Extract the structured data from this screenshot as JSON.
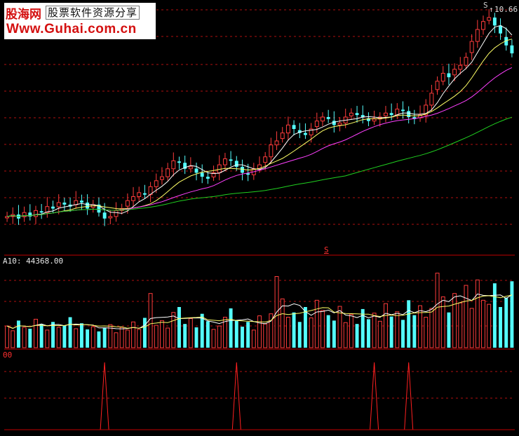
{
  "watermark": {
    "brand": "股海网",
    "subtitle": "股票软件资源分享",
    "url": "Www.Guhai.com.cn"
  },
  "labels": {
    "price_high": "10.66",
    "price_high_marker": "↑",
    "price_s_marker": "S",
    "mid_marker": "S",
    "volume_ma": "A10: 44368.00",
    "indicator": "00"
  },
  "colors": {
    "background": "#000000",
    "up": "#ff3c3c",
    "down": "#54ffff",
    "ma5": "#ffffff",
    "ma10": "#ffff66",
    "ma20": "#ff40ff",
    "ma60": "#20d020",
    "grid": "#b01010",
    "indicator": "#ff2020"
  },
  "chart_data": [
    {
      "type": "candlestick",
      "panel": "price",
      "series_names": [
        "MA5",
        "MA10",
        "MA20",
        "MA60"
      ],
      "ylim": [
        4.6,
        10.8
      ],
      "closes": [
        5.5,
        5.55,
        5.45,
        5.6,
        5.5,
        5.65,
        5.6,
        5.75,
        5.7,
        5.85,
        5.8,
        5.75,
        5.9,
        5.85,
        5.7,
        5.8,
        5.6,
        5.45,
        5.5,
        5.65,
        5.7,
        5.9,
        6.0,
        6.1,
        6.05,
        6.25,
        6.4,
        6.5,
        6.7,
        6.9,
        6.85,
        6.7,
        6.75,
        6.6,
        6.5,
        6.45,
        6.6,
        6.8,
        6.95,
        6.9,
        6.75,
        6.6,
        6.55,
        6.7,
        6.8,
        7.0,
        7.3,
        7.4,
        7.6,
        7.8,
        7.7,
        7.6,
        7.55,
        7.7,
        7.9,
        8.0,
        7.95,
        7.8,
        7.85,
        8.0,
        8.1,
        8.05,
        8.0,
        7.9,
        7.95,
        8.0,
        8.1,
        8.05,
        8.2,
        8.15,
        8.0,
        7.95,
        8.05,
        8.3,
        8.6,
        8.9,
        9.1,
        9.0,
        9.2,
        9.3,
        9.5,
        9.9,
        10.2,
        10.4,
        10.5,
        10.3,
        10.1,
        9.8,
        9.6
      ]
    },
    {
      "type": "bar",
      "panel": "volume",
      "series_names": [
        "VOL",
        "MA5",
        "MA10"
      ],
      "ylim": [
        0,
        120000
      ],
      "values": [
        32000,
        25000,
        40000,
        30000,
        28000,
        42000,
        35000,
        26000,
        38000,
        30000,
        33000,
        45000,
        28000,
        36000,
        27000,
        31000,
        24000,
        29000,
        34000,
        22000,
        30000,
        26000,
        38000,
        27000,
        44000,
        80000,
        33000,
        40000,
        29000,
        52000,
        60000,
        35000,
        43000,
        30000,
        50000,
        39000,
        27000,
        32000,
        45000,
        58000,
        40000,
        31000,
        38000,
        26000,
        47000,
        35000,
        50000,
        105000,
        72000,
        45000,
        52000,
        38000,
        60000,
        44000,
        70000,
        55000,
        48000,
        40000,
        61000,
        37000,
        49000,
        35000,
        57000,
        42000,
        51000,
        39000,
        65000,
        46000,
        53000,
        41000,
        70000,
        48000,
        62000,
        45000,
        58000,
        110000,
        75000,
        52000,
        80000,
        66000,
        92000,
        58000,
        100000,
        70000,
        64000,
        95000,
        60000,
        74000,
        98000
      ]
    },
    {
      "type": "spike",
      "panel": "indicator",
      "signal_indices": [
        17,
        40,
        64,
        70
      ]
    }
  ]
}
